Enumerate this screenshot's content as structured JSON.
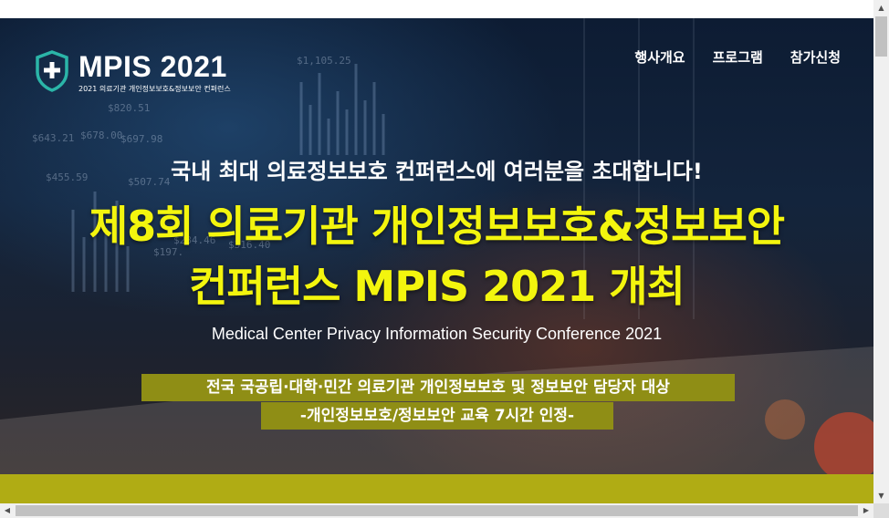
{
  "header": {
    "logo_title": "MPIS 2021",
    "logo_subtitle": "2021 의료기관 개인정보보호&정보보안 컨퍼런스",
    "nav": [
      {
        "label": "행사개요"
      },
      {
        "label": "프로그램"
      },
      {
        "label": "참가신청"
      }
    ]
  },
  "hero": {
    "invite": "국내 최대 의료정보보호 컨퍼런스에 여러분을 초대합니다!",
    "headline_line1": "제8회 의료기관 개인정보보호&정보보안",
    "headline_line2": "컨퍼런스 MPIS 2021 개최",
    "english_title": "Medical Center Privacy Information Security Conference 2021",
    "target_audience": "전국 국공립·대학·민간 의료기관 개인정보보호 및 정보보안 담당자 대상",
    "certification": "-개인정보보호/정보보안 교육 7시간 인정-",
    "background_numbers": [
      "$1,105.25",
      "$820.51",
      "$643.21",
      "$678.00",
      "$697.98",
      "$455.59",
      "$507.74",
      "$284.46",
      "$316.40",
      "$197."
    ]
  },
  "colors": {
    "headline_yellow": "#f3f50e",
    "olive": "#8f8e15",
    "band_olive": "#b0ac14",
    "shield_teal": "#2bb5a8"
  },
  "icons": {
    "logo": "shield-plus-icon",
    "scroll_up": "triangle-up-icon",
    "scroll_down": "triangle-down-icon",
    "scroll_left": "triangle-left-icon",
    "scroll_right": "triangle-right-icon"
  }
}
